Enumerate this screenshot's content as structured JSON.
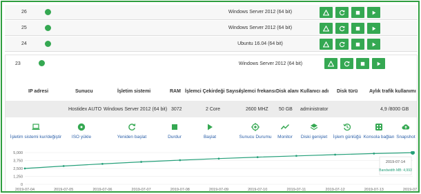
{
  "colors": {
    "accent": "#35a852",
    "frame": "#2e9e3e",
    "link": "#2b5fa8",
    "line": "#26a07a"
  },
  "servers": [
    {
      "id": "26",
      "os": "Windows Server 2012 (64 bit)"
    },
    {
      "id": "25",
      "os": "Windows Server 2012 (64 bit)"
    },
    {
      "id": "24",
      "os": "Ubuntu 16.04 (64 bit)"
    }
  ],
  "row_buttons": [
    "warning-icon",
    "refresh-icon",
    "stop-icon",
    "play-icon"
  ],
  "selected": {
    "id": "23",
    "os": "Windows Server 2012 (64 bit)",
    "headers": {
      "ip": "IP adresi",
      "server": "Sunucu",
      "os": "İşletim sistemi",
      "ram": "RAM",
      "cores": "İşlemci Çekirdeği Sayısı",
      "freq": "İşlemci frekansı",
      "disk": "Disk alanı",
      "user": "Kullanıcı adı",
      "disk_type": "Disk türü",
      "traffic": "Aylık trafik kullanımı"
    },
    "values": {
      "ip": "",
      "server": "Hostidex AUTO",
      "os": "Windows Server 2012 (64 bit)",
      "ram": "3072",
      "cores": "2 Core",
      "freq": "2600 MHZ",
      "disk": "50 GB",
      "user": "administrator",
      "disk_type": "",
      "traffic": "4,9 /8000 GB"
    }
  },
  "actions": [
    {
      "label": "İşletim sistemi kur/değiştir",
      "icon": "laptop-icon"
    },
    {
      "label": "ISO yükle",
      "icon": "disc-icon"
    },
    {
      "label": "Yeniden başlat",
      "icon": "refresh-icon"
    },
    {
      "label": "Durdur",
      "icon": "stop-icon"
    },
    {
      "label": "Başlat",
      "icon": "play-icon"
    },
    {
      "label": "Sunucu Durumu",
      "icon": "target-icon"
    },
    {
      "label": "Monitor",
      "icon": "trend-icon"
    },
    {
      "label": "Diski genişlet",
      "icon": "layers-icon"
    },
    {
      "label": "İşlem günlüğü",
      "icon": "history-icon"
    },
    {
      "label": "Konsola bağlan",
      "icon": "console-icon"
    },
    {
      "label": "Snapshot",
      "icon": "cloud-upload-icon"
    }
  ],
  "chart_data": {
    "type": "line",
    "x": [
      "2019-07-04",
      "2019-07-05",
      "2019-07-06",
      "2019-07-07",
      "2019-07-08",
      "2019-07-09",
      "2019-07-10",
      "2019-07-11",
      "2019-07-12",
      "2019-07-13",
      "2019-07-14"
    ],
    "series": [
      {
        "values": [
          2500,
          2880,
          3220,
          3530,
          3800,
          4050,
          4280,
          4480,
          4670,
          4850,
          4993
        ]
      }
    ],
    "yticks": [
      "0",
      "1,250",
      "2,500",
      "3,750",
      "5,000"
    ],
    "ylim": [
      0,
      5000
    ],
    "tooltip": {
      "date": "2019-07-14",
      "label": "Bandwidth MB: 4,993"
    },
    "grid": true
  }
}
